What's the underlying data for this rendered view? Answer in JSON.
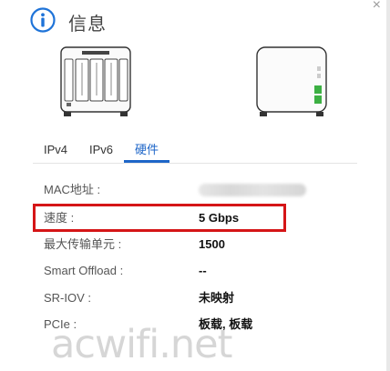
{
  "header": {
    "title": "信息",
    "icon": "info-icon",
    "close_glyph": "×"
  },
  "devices": {
    "front_image": "nas-front-image",
    "back_image": "nas-back-image"
  },
  "tabs": [
    {
      "label": "IPv4",
      "active": false
    },
    {
      "label": "IPv6",
      "active": false
    },
    {
      "label": "硬件",
      "active": true
    }
  ],
  "rows": [
    {
      "label": "MAC地址 :",
      "value": "",
      "blurred": true
    },
    {
      "label": "速度 :",
      "value": "5 Gbps",
      "highlighted": true
    },
    {
      "label": "最大传输单元 :",
      "value": "1500"
    },
    {
      "label": "Smart Offload :",
      "value": "--"
    },
    {
      "label": "SR-IOV :",
      "value": "未映射"
    },
    {
      "label": "PCIe :",
      "value": "板载, 板载"
    }
  ],
  "watermark": "acwifi.net",
  "colors": {
    "accent": "#1e66c8",
    "highlight": "#d51517",
    "led_green": "#3cb043"
  }
}
